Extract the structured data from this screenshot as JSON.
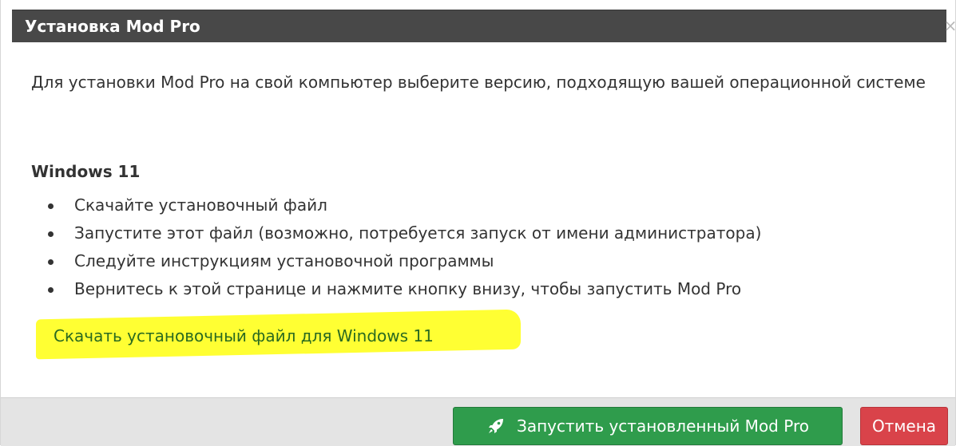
{
  "dialog": {
    "title": "Установка Mod Pro",
    "close_label": "×"
  },
  "content": {
    "intro": "Для установки Mod Pro на свой компьютер выберите версию, подходящую вашей операционной системе",
    "os_heading": "Windows 11",
    "steps": [
      "Скачайте установочный файл",
      "Запустите этот файл (возможно, потребуется запуск от имени администратора)",
      "Следуйте инструкциям установочной программы",
      "Вернитесь к этой странице и нажмите кнопку внизу, чтобы запустить Mod Pro"
    ],
    "download_link": "Скачать установочный файл для Windows 11"
  },
  "footer": {
    "launch_label": "Запустить установленный Mod Pro",
    "launch_icon": "rocket-icon",
    "cancel_label": "Отмена"
  },
  "colors": {
    "titlebar": "#484848",
    "launch_button": "#2f9c4c",
    "cancel_button": "#d9434a",
    "highlight": "#ffff33",
    "link": "#2a6a20"
  }
}
